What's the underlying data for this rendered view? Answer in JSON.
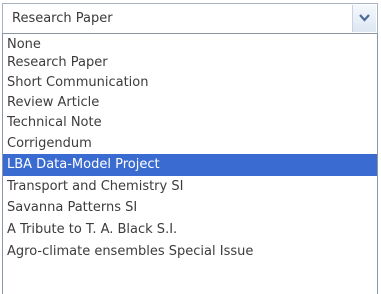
{
  "select": {
    "value": "Research Paper",
    "arrow_icon": "chevron-down-icon"
  },
  "dropdown": {
    "options": [
      {
        "label": "None"
      },
      {
        "label": "Research Paper"
      },
      {
        "label": "Short Communication"
      },
      {
        "label": "Review Article"
      },
      {
        "label": "Technical Note"
      },
      {
        "label": "Corrigendum"
      },
      {
        "label": "LBA Data-Model Project"
      },
      {
        "label": "Transport and Chemistry SI"
      },
      {
        "label": "Savanna Patterns SI"
      },
      {
        "label": "A Tribute to T. A. Black S.I."
      },
      {
        "label": "Agro-climate ensembles Special Issue"
      }
    ],
    "highlighted_label": "LBA Data-Model Project"
  },
  "colors": {
    "highlight": "#3a6bd0",
    "text": "#3c3c3c"
  }
}
